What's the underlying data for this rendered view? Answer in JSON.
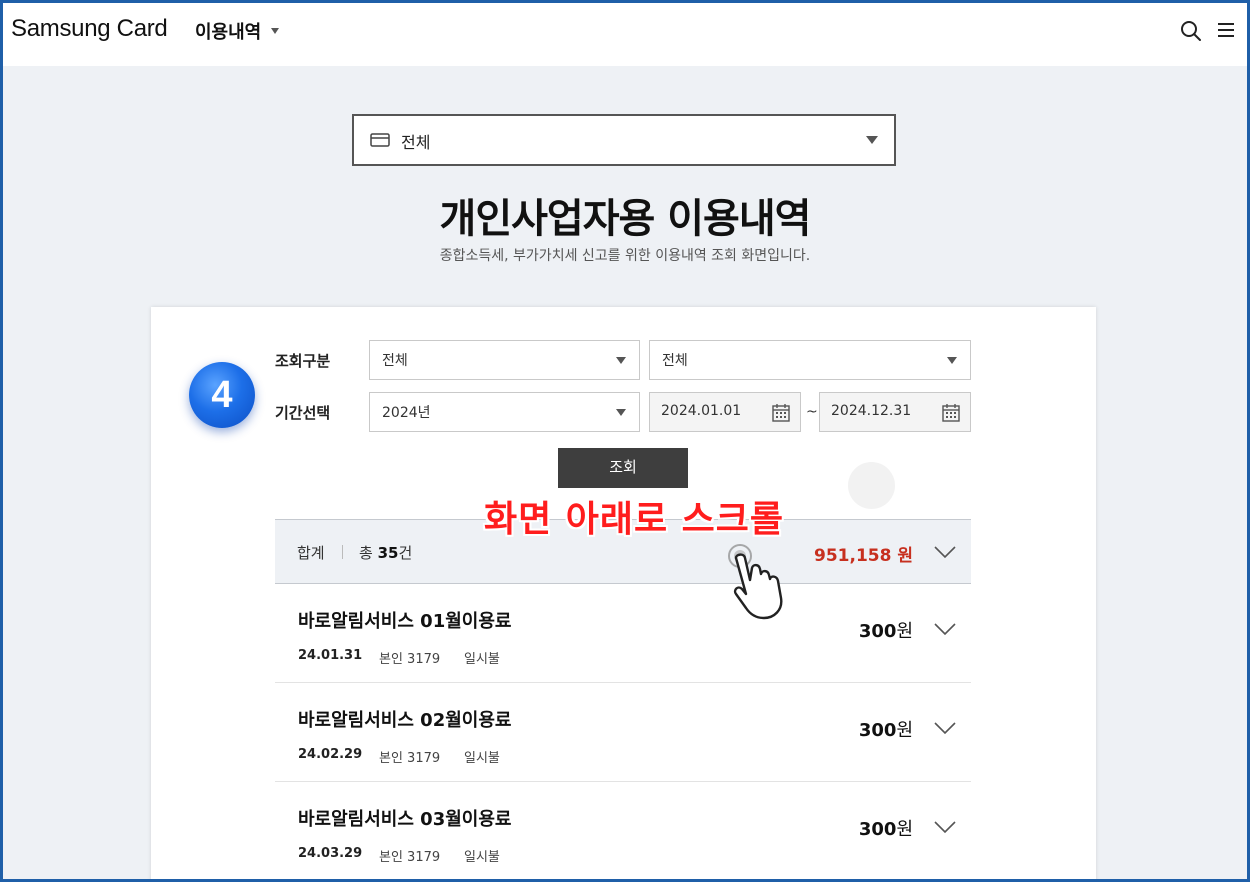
{
  "header": {
    "logo": "Samsung Card",
    "menu_title": "이용내역"
  },
  "card_select": {
    "value": "전체"
  },
  "page": {
    "title": "개인사업자용 이용내역",
    "subtitle": "종합소득세, 부가가치세 신고를 위한 이용내역 조회 화면입니다."
  },
  "step_badge": "4",
  "filters": {
    "inquiry_label": "조회구분",
    "inquiry_select_1": "전체",
    "inquiry_select_2": "전체",
    "period_label": "기간선택",
    "year_select": "2024년",
    "start_date": "2024.01.01",
    "range_sep": "~",
    "end_date": "2024.12.31",
    "search_button": "조회"
  },
  "overlay_hint": "화면 아래로 스크롤",
  "summary": {
    "label": "합계",
    "count_prefix": "총",
    "count": "35",
    "count_suffix": "건",
    "total": "951,158 원"
  },
  "transactions": [
    {
      "name": "바로알림서비스 01월이용료",
      "date": "24.01.31",
      "owner": "본인 3179",
      "payment": "일시불",
      "amount": "300",
      "unit": "원"
    },
    {
      "name": "바로알림서비스 02월이용료",
      "date": "24.02.29",
      "owner": "본인 3179",
      "payment": "일시불",
      "amount": "300",
      "unit": "원"
    },
    {
      "name": "바로알림서비스 03월이용료",
      "date": "24.03.29",
      "owner": "본인 3179",
      "payment": "일시불",
      "amount": "300",
      "unit": "원"
    }
  ],
  "colors": {
    "frame": "#1f5fa8",
    "accent_red": "#c7301f",
    "hint_red": "#ff1d1d",
    "badge_blue": "#1d6fe8",
    "button_dark": "#3e3e3e"
  }
}
